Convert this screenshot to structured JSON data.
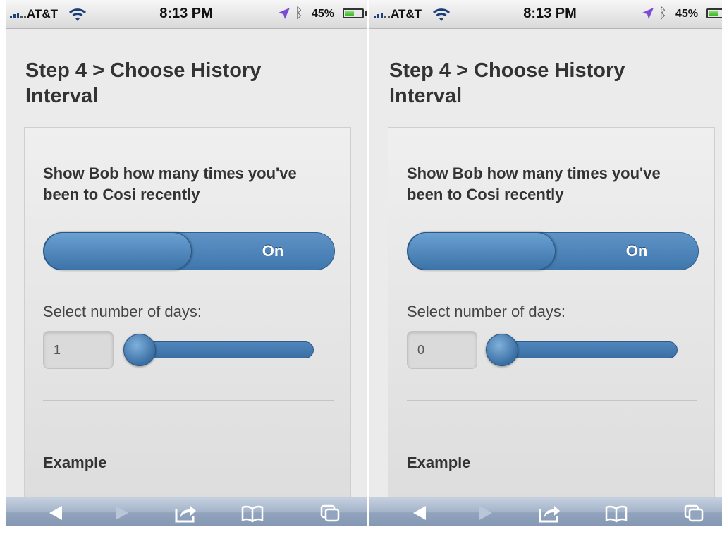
{
  "screens": [
    {
      "status_bar": {
        "carrier": "AT&T",
        "time": "8:13 PM",
        "battery": "45%"
      },
      "page": {
        "heading": "Step 4 > Choose History Interval",
        "card": {
          "title": "Show Bob how many times you've been to Cosi recently",
          "toggle_label": "On",
          "days_label": "Select number of days:",
          "days_value": "1",
          "slider_value": 1,
          "example_heading": "Example"
        }
      }
    },
    {
      "status_bar": {
        "carrier": "AT&T",
        "time": "8:13 PM",
        "battery": "45%"
      },
      "page": {
        "heading": "Step 4 > Choose History Interval",
        "card": {
          "title": "Show Bob how many times you've been to Cosi recently",
          "toggle_label": "On",
          "days_label": "Select number of days:",
          "days_value": "0",
          "slider_value": 0,
          "example_heading": "Example"
        }
      }
    }
  ],
  "toolbar_icons": [
    "back-arrow-icon",
    "forward-arrow-icon",
    "share-icon",
    "bookmarks-icon",
    "pages-icon"
  ],
  "colors": {
    "accent": "#4a7fb5",
    "toolbar": "#9fb0c6",
    "page_bg": "#ebebeb"
  }
}
